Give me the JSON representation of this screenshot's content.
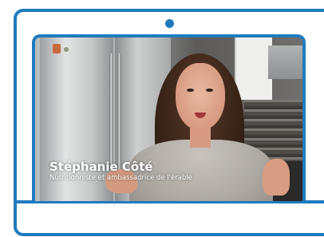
{
  "video": {
    "speaker_name": "Stéphanie Côté",
    "speaker_role": "Nutritionniste et ambassadrice de l'érable"
  },
  "colors": {
    "frame": "#1f7bbf",
    "caption_text": "#ffffff"
  },
  "icons": {
    "camera": "camera-dot-icon"
  }
}
